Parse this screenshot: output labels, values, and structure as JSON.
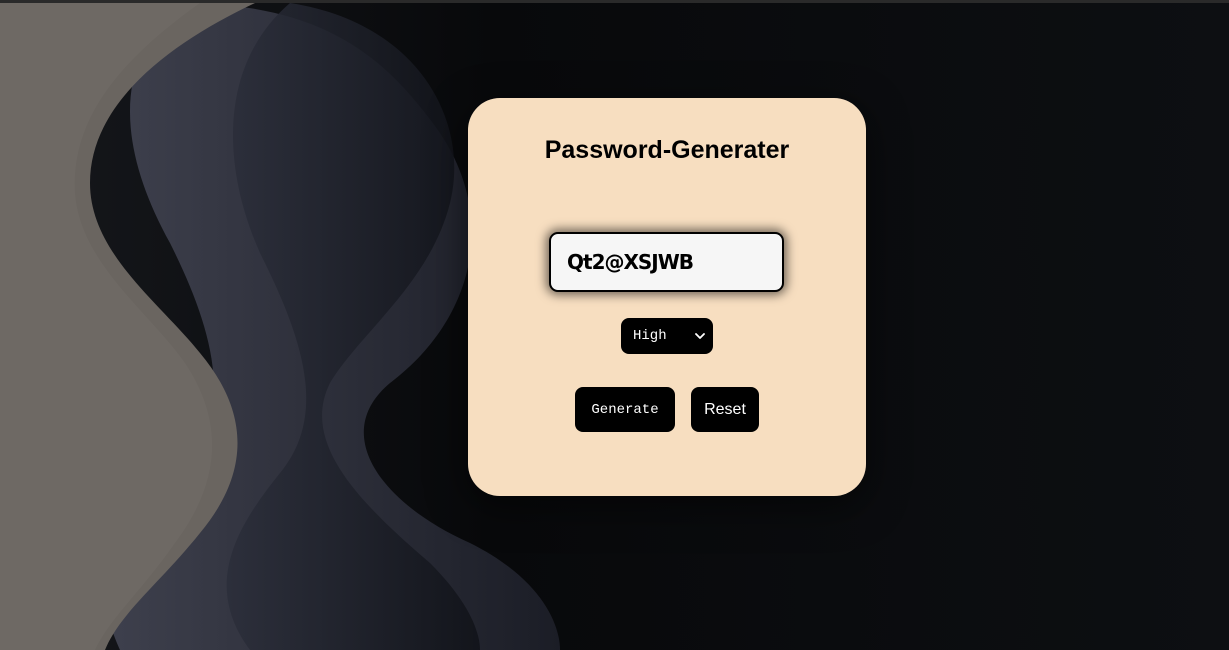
{
  "colors": {
    "card_background": "#f7dec0",
    "button_background": "#000000",
    "button_text": "#ffffff",
    "page_background": "#0b0d10"
  },
  "app": {
    "title": "Password-Generater"
  },
  "password": {
    "value": "Qt2@XSJWB"
  },
  "strength": {
    "selected": "High"
  },
  "actions": {
    "generate_label": "Generate",
    "reset_label": "Reset"
  }
}
